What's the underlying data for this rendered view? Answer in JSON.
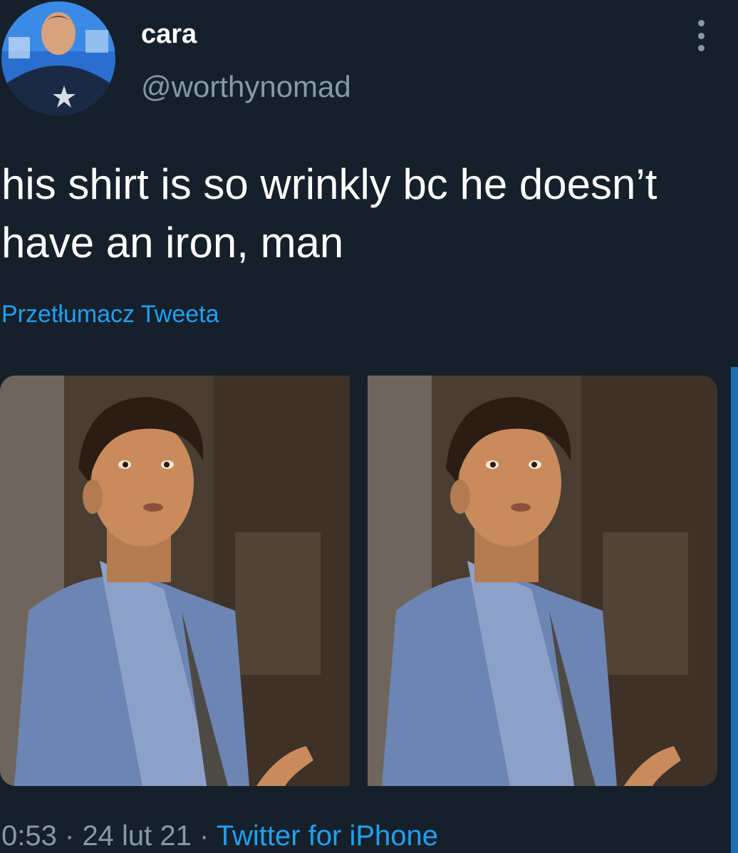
{
  "tweet": {
    "display_name": "cara",
    "handle": "@worthynomad",
    "text": "his shirt is so wrinkly bc he doesn’t have an iron, man",
    "translate_label": "Przetłumacz Tweeta",
    "time": "0:53",
    "separator": "·",
    "date": "24 lut 21",
    "source": "Twitter for iPhone"
  },
  "icons": {
    "more": "more-options-icon"
  },
  "colors": {
    "background": "#15202b",
    "link": "#1da1f2",
    "secondary_text": "#8899a6"
  }
}
